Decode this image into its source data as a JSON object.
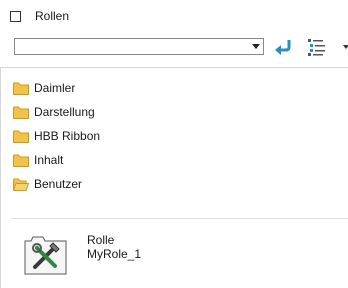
{
  "header": {
    "title": "Rollen"
  },
  "toolbar": {
    "combo_value": ""
  },
  "folders": [
    {
      "label": "Daimler",
      "state": "closed"
    },
    {
      "label": "Darstellung",
      "state": "closed"
    },
    {
      "label": "HBB Ribbon",
      "state": "closed"
    },
    {
      "label": "Inhalt",
      "state": "closed"
    },
    {
      "label": "Benutzer",
      "state": "open"
    }
  ],
  "role": {
    "type_label": "Rolle",
    "name": "MyRole_1"
  },
  "colors": {
    "folder": "#f2c24b",
    "accent": "#2a8fbd"
  }
}
